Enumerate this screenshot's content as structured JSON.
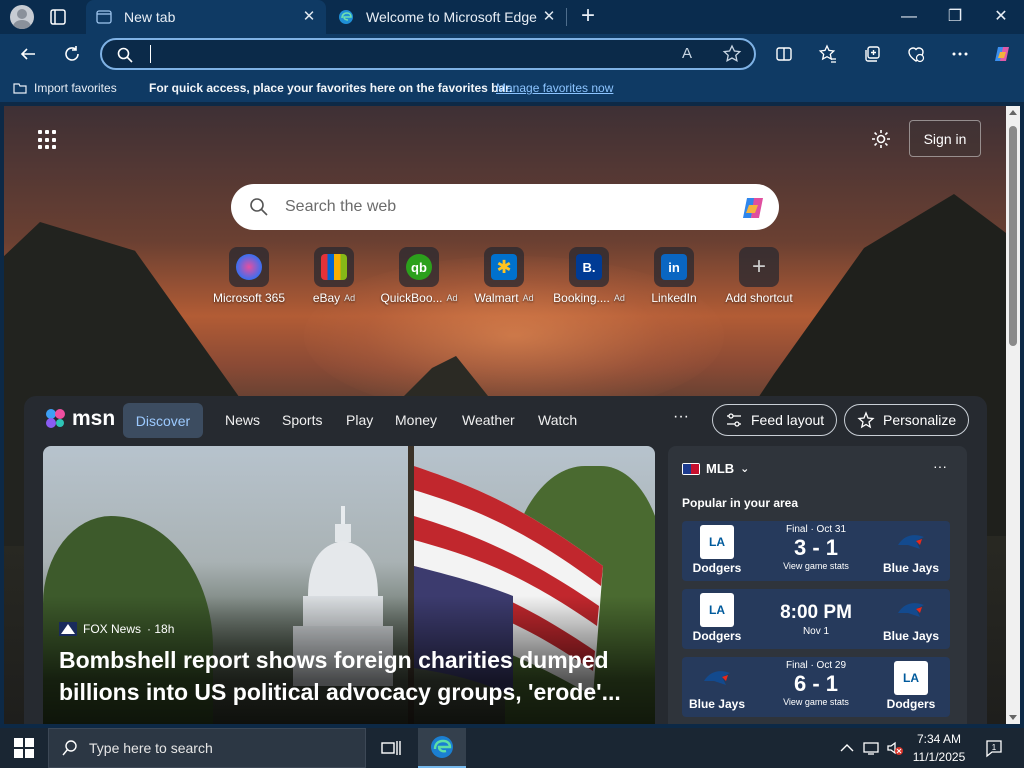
{
  "browser": {
    "tabs": [
      {
        "title": "New tab",
        "active": true
      },
      {
        "title": "Welcome to Microsoft Edge",
        "active": false
      }
    ],
    "address": {
      "value": "",
      "placeholder": ""
    },
    "read_aloud_glyph": "A",
    "window_controls": {
      "minimize": "—",
      "maximize": "❐",
      "close": "✕"
    }
  },
  "favorites_bar": {
    "import_label": "Import favorites",
    "message": "For quick access, place your favorites here on the favorites bar.",
    "manage_link": "Manage favorites now"
  },
  "newtab": {
    "signin_label": "Sign in",
    "search_placeholder": "Search the web",
    "shortcuts": [
      {
        "label": "Microsoft 365",
        "ad": "",
        "icon": "microsoft-365-icon"
      },
      {
        "label": "eBay",
        "ad": "Ad",
        "icon": "ebay-icon"
      },
      {
        "label": "QuickBoo...",
        "ad": "Ad",
        "icon": "quickbooks-icon"
      },
      {
        "label": "Walmart",
        "ad": "Ad",
        "icon": "walmart-icon"
      },
      {
        "label": "Booking....",
        "ad": "Ad",
        "icon": "booking-icon"
      },
      {
        "label": "LinkedIn",
        "ad": "",
        "icon": "linkedin-icon"
      },
      {
        "label": "Add shortcut",
        "ad": "",
        "icon": "plus-icon"
      }
    ]
  },
  "feed": {
    "logo_text": "msn",
    "nav": [
      "Discover",
      "News",
      "Sports",
      "Play",
      "Money",
      "Weather",
      "Watch"
    ],
    "more": "···",
    "feed_layout_label": "Feed layout",
    "personalize_label": "Personalize",
    "hero": {
      "source": "FOX News",
      "age": "· 18h",
      "headline": "Bombshell report shows foreign charities dumped billions into US political advocacy groups, 'erode'..."
    },
    "mlb": {
      "title": "MLB",
      "subtitle": "Popular in your area",
      "games": [
        {
          "status": "Final · Oct 31",
          "score": "3 - 1",
          "link": "View game stats",
          "home": "Dodgers",
          "away": "Blue Jays",
          "home_logo": "LA"
        },
        {
          "status": "Nov 1",
          "time": "8:00 PM",
          "home": "Dodgers",
          "away": "Blue Jays",
          "home_logo": "LA"
        },
        {
          "status": "Final · Oct 29",
          "score": "6 - 1",
          "link": "View game stats",
          "home": "Blue Jays",
          "away": "Dodgers",
          "away_logo": "LA"
        }
      ]
    }
  },
  "taskbar": {
    "search_placeholder": "Type here to search",
    "time": "7:34 AM",
    "date": "11/1/2025",
    "notification_count": "1"
  },
  "colors": {
    "titlebar": "#0a2c4e",
    "toolbar": "#0f3a64",
    "accent_link": "#8cc4ff",
    "mlb_card": "#263a5c"
  }
}
